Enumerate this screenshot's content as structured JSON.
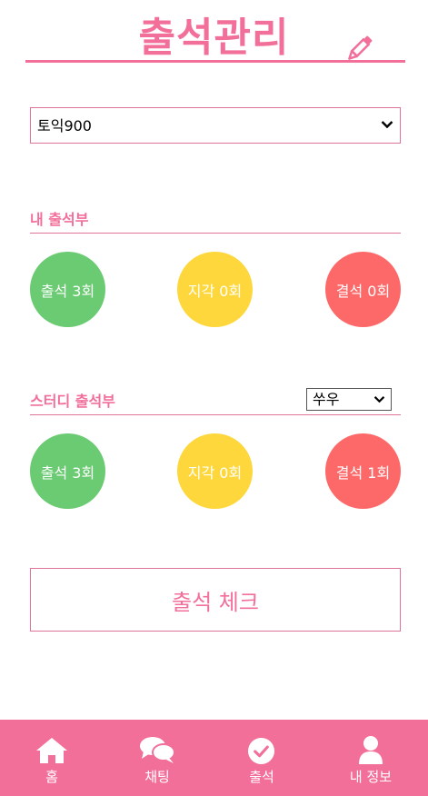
{
  "header": {
    "title": "출석관리",
    "edit_icon": "pencil-icon"
  },
  "study_select": {
    "selected": "토익900",
    "icon": "chevron-down-icon"
  },
  "my_attendance": {
    "title": "내 출석부",
    "stats": [
      {
        "label": "출석 3회",
        "color": "#6acb72"
      },
      {
        "label": "지각 0회",
        "color": "#fed73c"
      },
      {
        "label": "결석 0회",
        "color": "#fd6969"
      }
    ]
  },
  "study_attendance": {
    "title": "스터디 출석부",
    "member_select": "쑤우",
    "stats": [
      {
        "label": "출석 3회",
        "color": "#6acb72"
      },
      {
        "label": "지각 0회",
        "color": "#fed73c"
      },
      {
        "label": "결석 1회",
        "color": "#fd6969"
      }
    ]
  },
  "check_button": "출석 체크",
  "navbar": {
    "items": [
      {
        "label": "홈",
        "icon": "home-icon"
      },
      {
        "label": "채팅",
        "icon": "chat-icon"
      },
      {
        "label": "출석",
        "icon": "check-circle-icon"
      },
      {
        "label": "내 정보",
        "icon": "user-icon"
      }
    ]
  },
  "colors": {
    "accent": "#f26f99",
    "nav_bg": "#f26f99"
  }
}
